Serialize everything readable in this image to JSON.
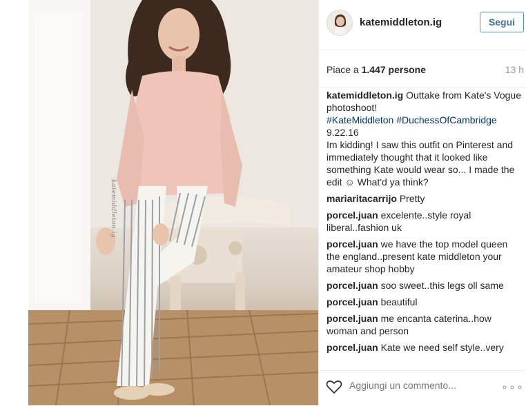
{
  "post": {
    "username": "katemiddleton.ig",
    "follow_label": "Segui",
    "likes_prefix": "Piace a ",
    "likes_count": "1.447",
    "likes_suffix": " persone",
    "time_ago": "13 h",
    "photo_watermark": "katemiddleton.ig"
  },
  "caption": {
    "user": "katemiddleton.ig",
    "line1": "Outtake from Kate's Vogue photoshoot!",
    "hashtag1": "#KateMiddleton",
    "hashtag2": "#DuchessOfCambridge",
    "date": "9.22.16",
    "body": "Im kidding! I saw this outfit on Pinterest and immediately thought that it looked like something Kate would wear so... I made the edit ☺ What'd ya think?"
  },
  "comments": [
    {
      "user": "mariaritacarrijo",
      "text": "Pretty"
    },
    {
      "user": "porcel.juan",
      "text": "excelente..style royal liberal..fashion uk"
    },
    {
      "user": "porcel.juan",
      "text": "we have the top model queen the england..present kate middleton your amateur shop hobby"
    },
    {
      "user": "porcel.juan",
      "text": "soo sweet..this legs oll same"
    },
    {
      "user": "porcel.juan",
      "text": "beautiful"
    },
    {
      "user": "porcel.juan",
      "text": "me encanta caterina..how woman and person"
    },
    {
      "user": "porcel.juan",
      "text": "Kate we need self style..very"
    }
  ],
  "footer": {
    "comment_placeholder": "Aggiungi un commento...",
    "more_glyph": "∘∘∘",
    "heart_icon": "heart-icon"
  },
  "colors": {
    "link": "#003569",
    "follow_border": "#4a90d9",
    "follow_text": "#3f729b"
  }
}
